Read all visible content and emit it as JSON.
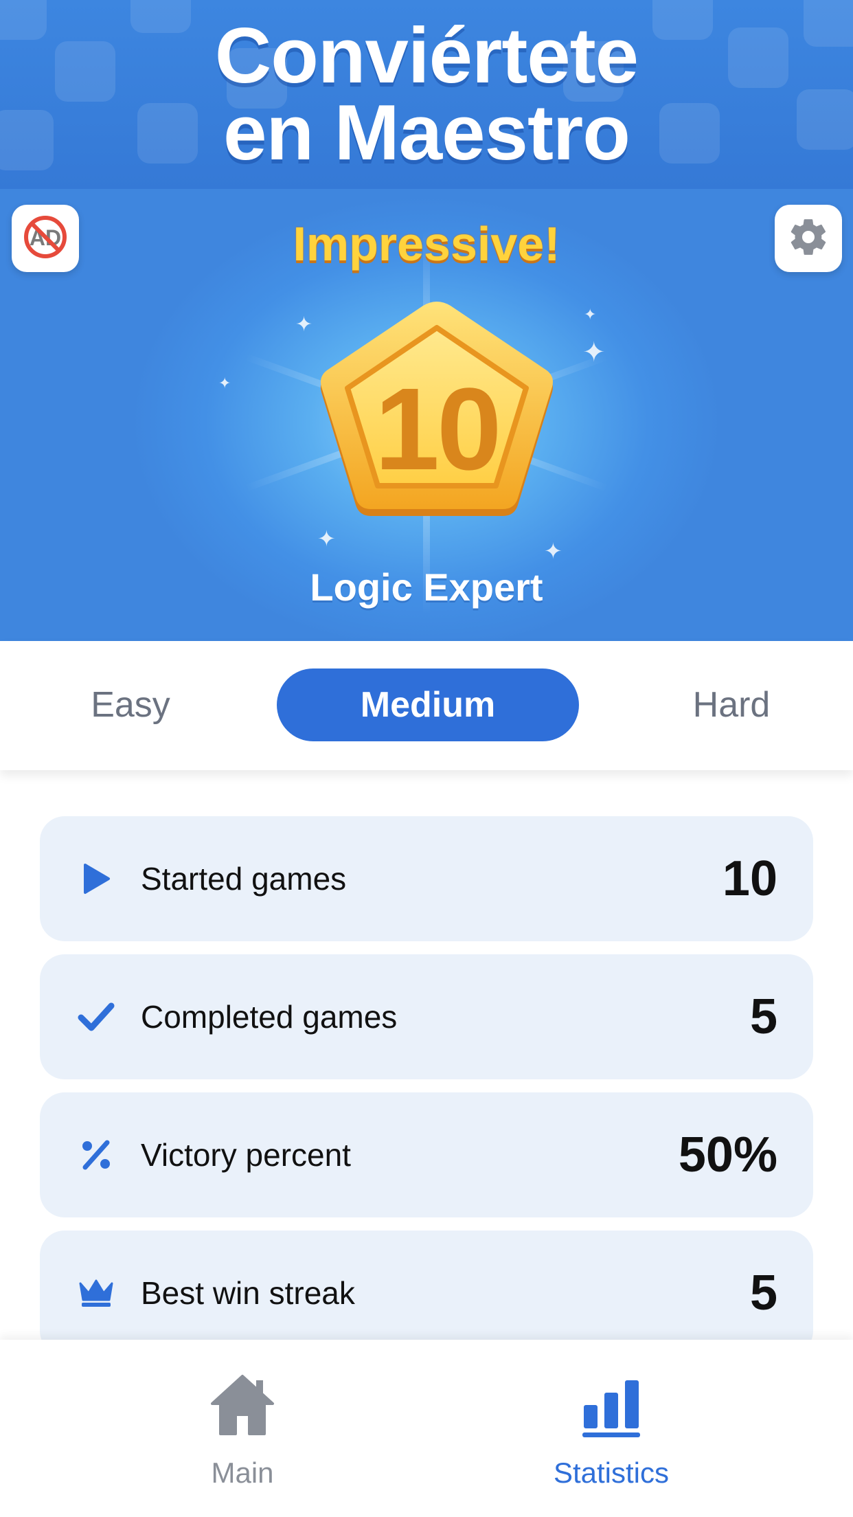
{
  "banner": {
    "title_line1": "Conviértete",
    "title_line2": "en Maestro"
  },
  "hero": {
    "heading": "Impressive!",
    "badge_number": "10",
    "rank_title": "Logic Expert",
    "no_ads_icon": "no-ads-icon",
    "settings_icon": "gear-icon"
  },
  "tabs": {
    "items": [
      {
        "label": "Easy"
      },
      {
        "label": "Medium"
      },
      {
        "label": "Hard"
      }
    ],
    "selected": "Medium"
  },
  "stats": [
    {
      "icon": "play-icon",
      "label": "Started games",
      "value": "10"
    },
    {
      "icon": "check-icon",
      "label": "Completed games",
      "value": "5"
    },
    {
      "icon": "percent-icon",
      "label": "Victory percent",
      "value": "50%"
    },
    {
      "icon": "crown-icon",
      "label": "Best win streak",
      "value": "5"
    }
  ],
  "bottom_nav": {
    "items": [
      {
        "icon": "home-icon",
        "label": "Main"
      },
      {
        "icon": "bar-chart-icon",
        "label": "Statistics"
      }
    ],
    "active": "Statistics"
  },
  "colors": {
    "accent": "#2f6fd9",
    "banner": "#3579d6",
    "gold": "#ffd33d",
    "stat_card": "#eaf1fa",
    "inactive": "#8a8f98"
  }
}
